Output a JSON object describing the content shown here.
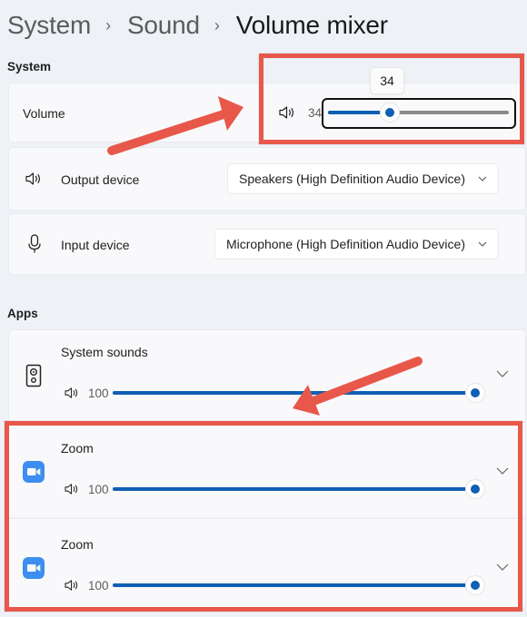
{
  "breadcrumb": {
    "items": [
      "System",
      "Sound",
      "Volume mixer"
    ],
    "separator": "›"
  },
  "system_section": {
    "title": "System",
    "volume": {
      "label": "Volume",
      "value_text": "34",
      "value": 34,
      "max": 100,
      "tooltip": "34"
    },
    "output_device": {
      "label": "Output device",
      "selected": "Speakers (High Definition Audio Device)"
    },
    "input_device": {
      "label": "Input device",
      "selected": "Microphone (High Definition Audio Device)"
    }
  },
  "apps_section": {
    "title": "Apps",
    "apps": [
      {
        "name": "System sounds",
        "icon": "speaker-device-icon",
        "volume_text": "100",
        "volume": 100
      },
      {
        "name": "Zoom",
        "icon": "zoom-app-icon",
        "volume_text": "100",
        "volume": 100
      },
      {
        "name": "Zoom",
        "icon": "zoom-app-icon",
        "volume_text": "100",
        "volume": 100
      }
    ]
  },
  "colors": {
    "accent": "#0f5fb3",
    "annotation": "#e8584a",
    "zoom_brand": "#2d8cff"
  }
}
